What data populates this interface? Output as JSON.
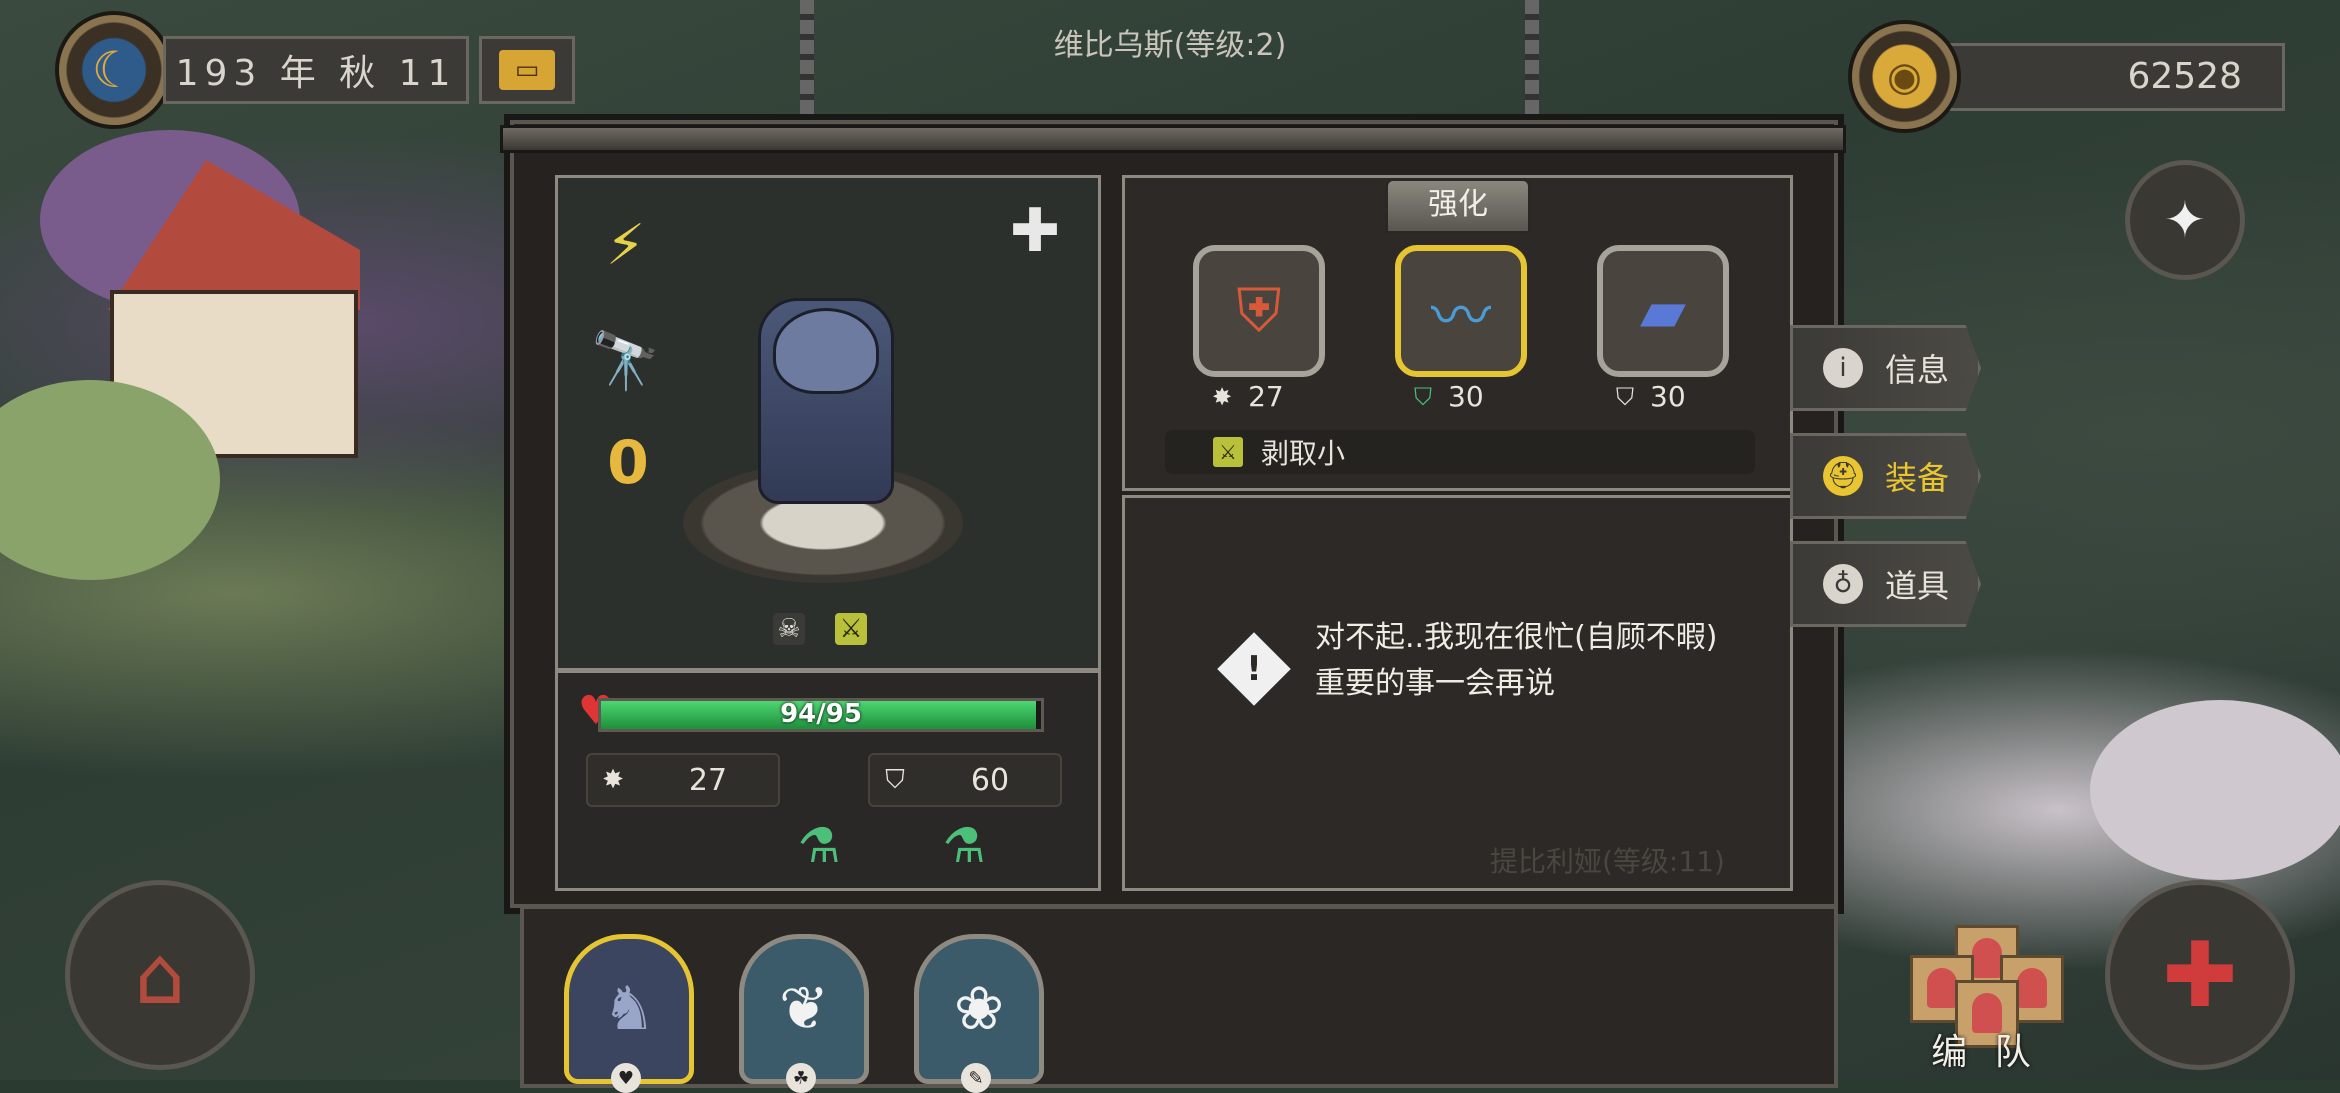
{
  "hud": {
    "date_text": "193 年 秋 11",
    "gold_amount": "62528",
    "top_title": "维比乌斯(等级:2)"
  },
  "character": {
    "level_badge": "0",
    "hp_text": "94/95",
    "hp_fraction": 0.989,
    "attack": "27",
    "defense": "60"
  },
  "equipment": {
    "strengthen_label": "强化",
    "slots": [
      {
        "icon": "armor-icon",
        "stat": "27"
      },
      {
        "icon": "scarf-icon",
        "stat": "30"
      },
      {
        "icon": "bracer-icon",
        "stat": "30"
      }
    ],
    "skill_label": "剥取小"
  },
  "message": {
    "text": "对不起..我现在很忙(自顾不暇)重要的事一会再说",
    "watermark": "提比利娅(等级:11)"
  },
  "tabs": [
    {
      "label": "信息",
      "icon": "info-icon",
      "active": false
    },
    {
      "label": "装备",
      "icon": "helmet-icon",
      "active": true
    },
    {
      "label": "道具",
      "icon": "potion-bag-icon",
      "active": false
    }
  ],
  "roster": {
    "team_label": "编 队"
  },
  "colors": {
    "highlight": "#e5c531",
    "hp_green": "#2fae52",
    "panel_bg": "#2c2926"
  }
}
